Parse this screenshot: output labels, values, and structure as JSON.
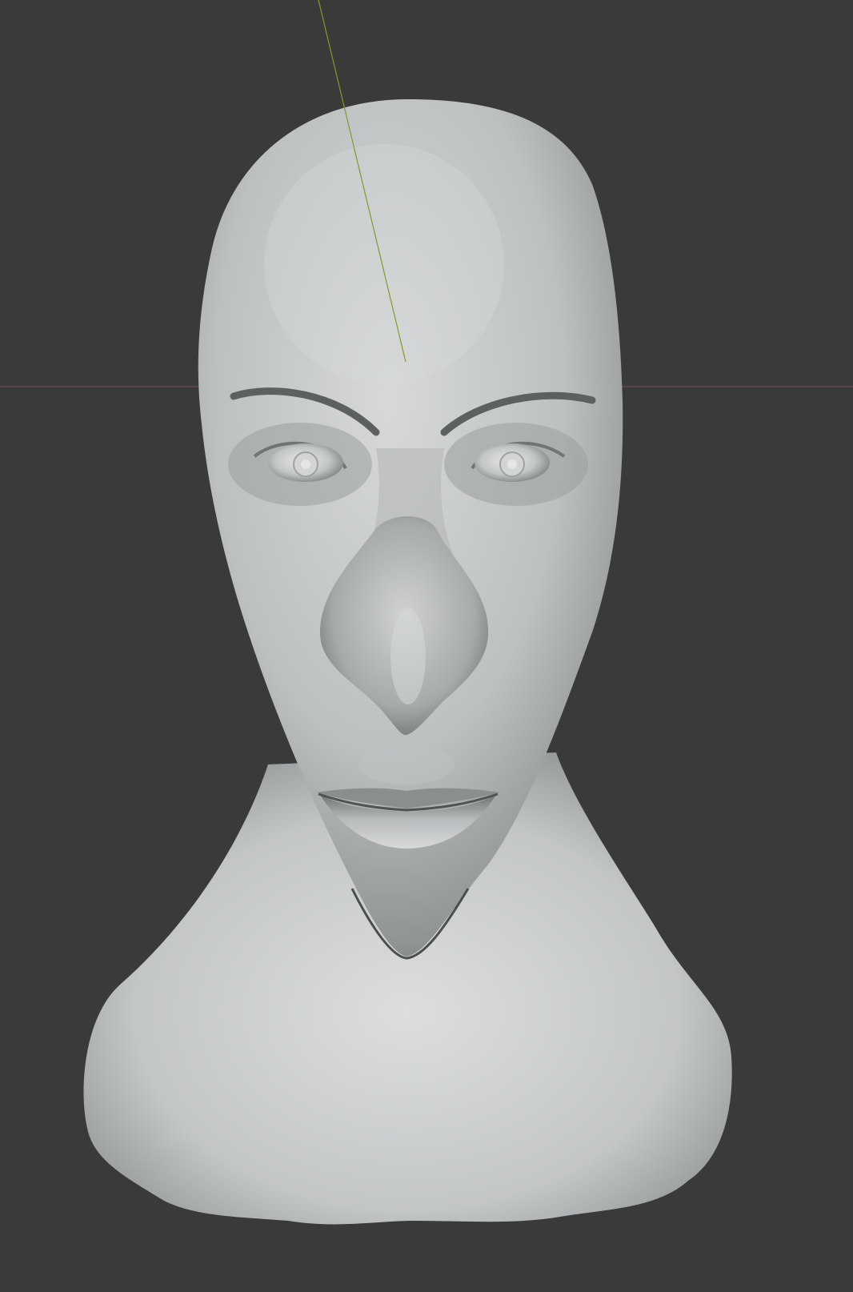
{
  "app": {
    "type": "3D viewport"
  },
  "viewport": {
    "background_color": "#3a3a3a",
    "grid_axes": {
      "x_axis_color": "#7a4a55",
      "y_axis_color": "#7f9a2e"
    },
    "mesh": {
      "name_visible": "",
      "base_color": "#c9cbcb",
      "shade_color": "#8f9393",
      "shadow_color": "#5e6262",
      "highlight_color": "#dcdede"
    }
  }
}
